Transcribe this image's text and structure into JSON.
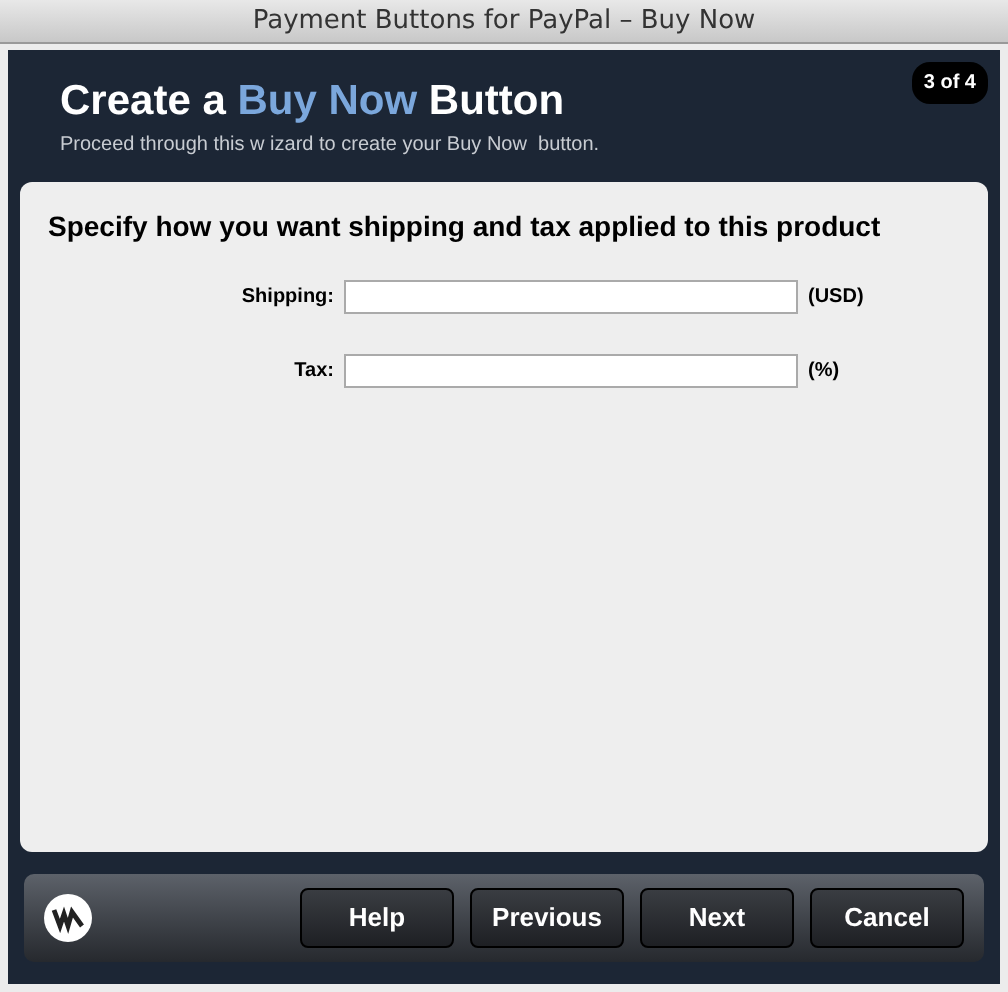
{
  "window": {
    "title": "Payment Buttons for PayPal – Buy Now"
  },
  "header": {
    "title_parts": [
      {
        "text": "Create a ",
        "highlight": false
      },
      {
        "text": "Buy Now",
        "highlight": true
      },
      {
        "text": " Button",
        "highlight": false
      }
    ],
    "subtitle": "Proceed through this w izard to create your Buy Now  button.",
    "step": "3 of 4"
  },
  "content": {
    "heading": "Specify how you want shipping and tax applied to this product",
    "fields": [
      {
        "label": "Shipping:",
        "unit": "(USD)"
      },
      {
        "label": "Tax:",
        "unit": "(%)"
      }
    ]
  },
  "footer": {
    "buttons": [
      "Help",
      "Previous",
      "Next",
      "Cancel"
    ]
  }
}
